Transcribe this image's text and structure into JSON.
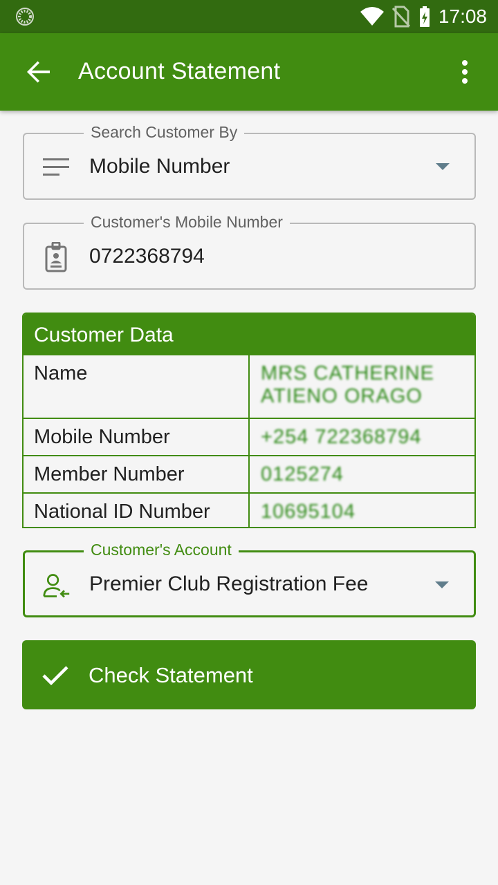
{
  "status_bar": {
    "time": "17:08"
  },
  "app_bar": {
    "title": "Account Statement"
  },
  "search_by": {
    "label": "Search Customer By",
    "value": "Mobile Number"
  },
  "mobile_field": {
    "label": "Customer's Mobile Number",
    "value": "0722368794"
  },
  "customer_data": {
    "title": "Customer Data",
    "rows": [
      {
        "key": "Name",
        "value": "MRS CATHERINE ATIENO ORAGO"
      },
      {
        "key": "Mobile Number",
        "value": "+254 722368794"
      },
      {
        "key": "Member Number",
        "value": "0125274"
      },
      {
        "key": "National ID Number",
        "value": "10695104"
      }
    ]
  },
  "account_field": {
    "label": "Customer's Account",
    "value": "Premier Club Registration Fee"
  },
  "cta": {
    "label": "Check Statement"
  },
  "colors": {
    "primary": "#418c11",
    "status_bar": "#326b10",
    "background": "#f5f5f5"
  }
}
